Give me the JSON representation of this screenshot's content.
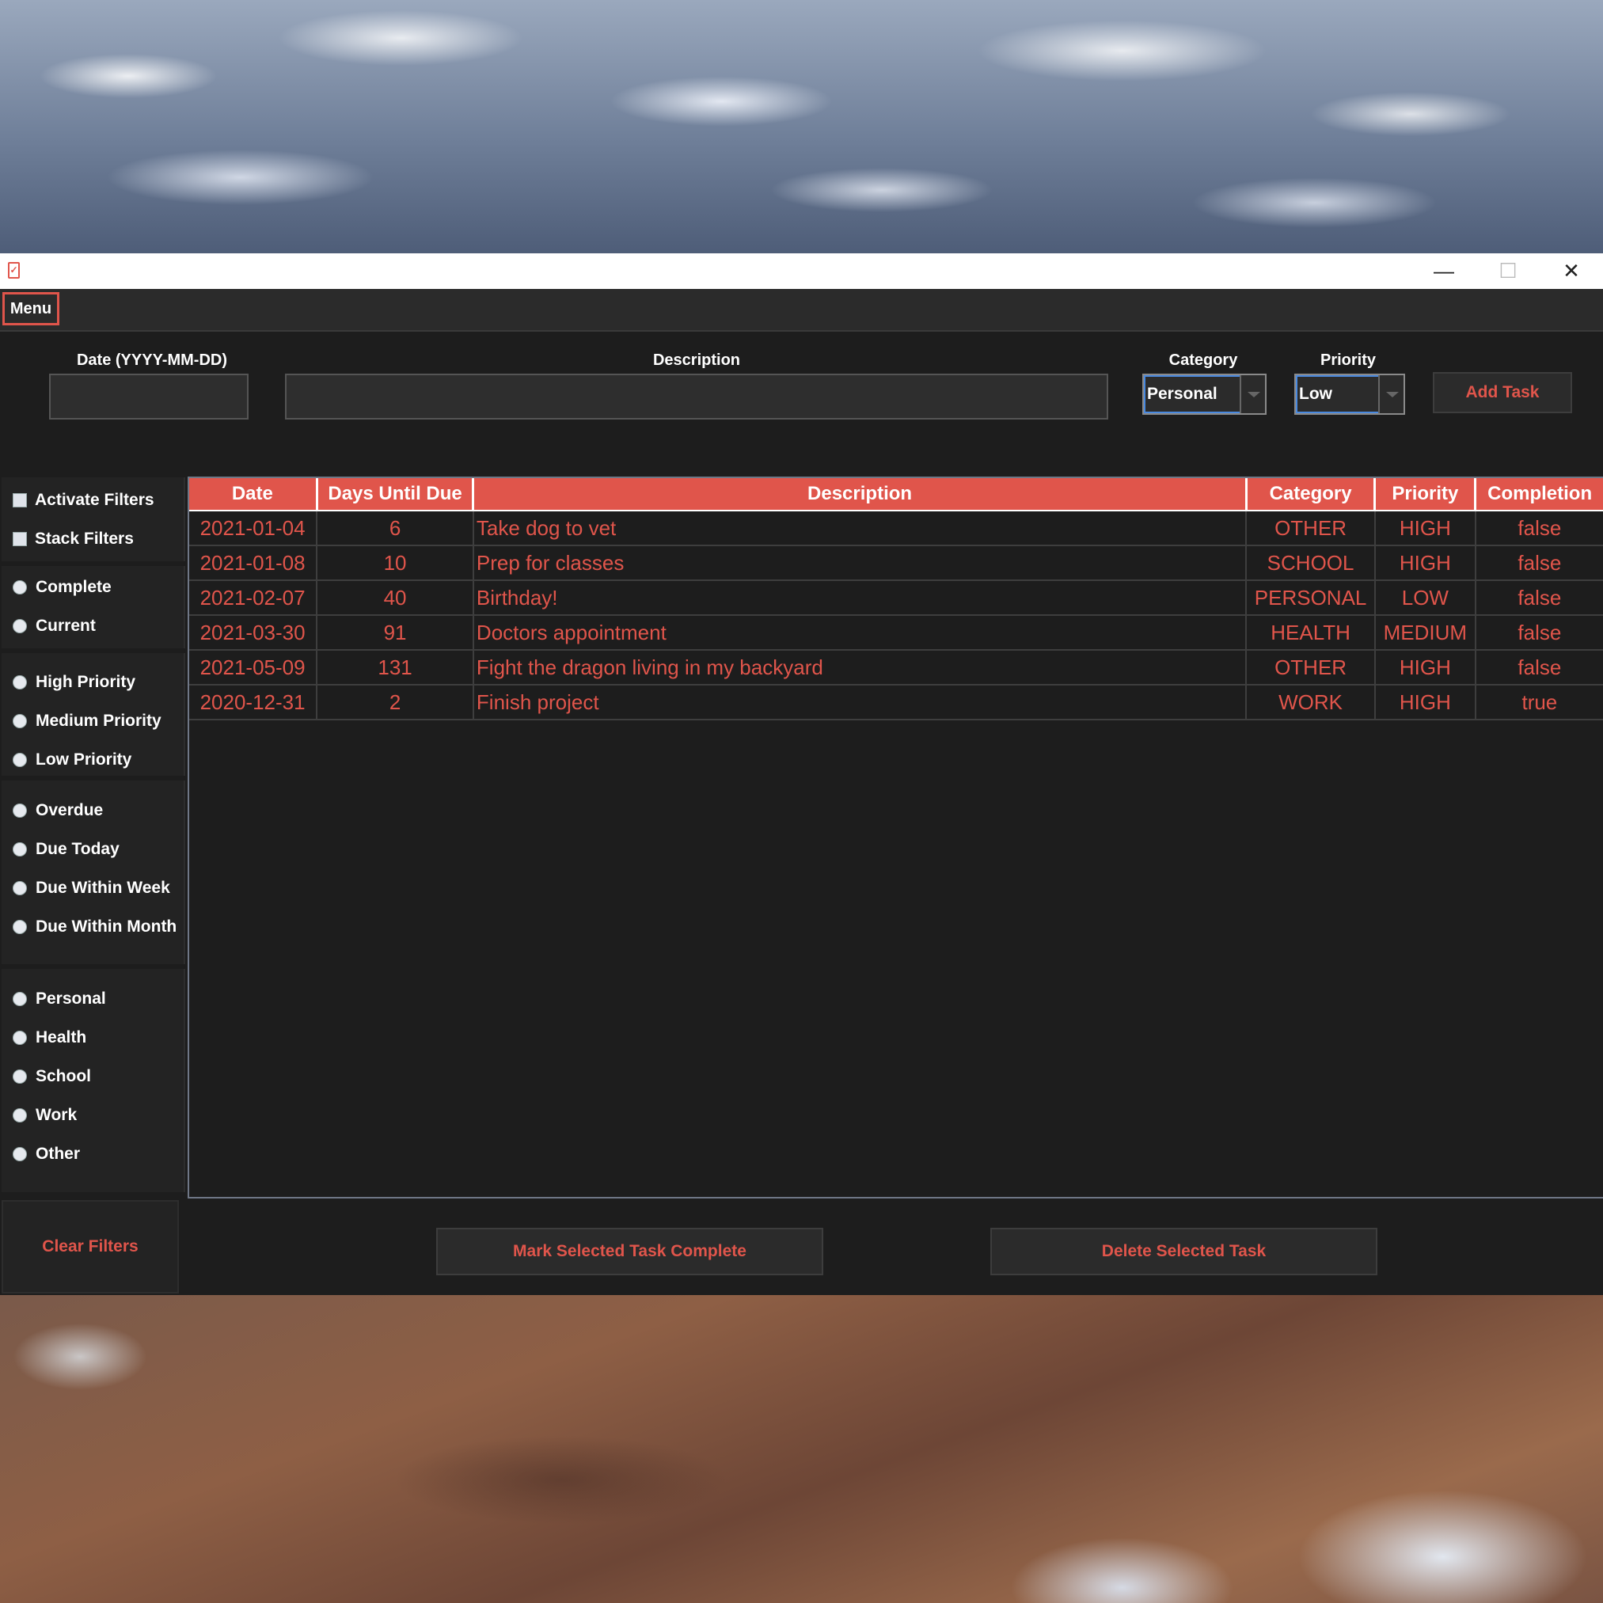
{
  "window": {
    "app_icon": "clipboard-icon",
    "controls": {
      "minimize": "—",
      "maximize": "☐",
      "close": "✕"
    }
  },
  "menu": {
    "label": "Menu"
  },
  "form": {
    "date_label": "Date (YYYY-MM-DD)",
    "date_value": "",
    "description_label": "Description",
    "description_value": "",
    "category_label": "Category",
    "category_value": "Personal",
    "priority_label": "Priority",
    "priority_value": "Low",
    "add_button": "Add Task"
  },
  "filters": {
    "toggles": [
      "Activate Filters",
      "Stack Filters"
    ],
    "status": [
      "Complete",
      "Current"
    ],
    "priority": [
      "High Priority",
      "Medium Priority",
      "Low Priority"
    ],
    "due": [
      "Overdue",
      "Due Today",
      "Due Within Week",
      "Due Within Month"
    ],
    "category": [
      "Personal",
      "Health",
      "School",
      "Work",
      "Other"
    ],
    "clear_button": "Clear Filters"
  },
  "table": {
    "columns": [
      "Date",
      "Days Until Due",
      "Description",
      "Category",
      "Priority",
      "Completion"
    ],
    "rows": [
      [
        "2021-01-04",
        "6",
        "Take dog to vet",
        "OTHER",
        "HIGH",
        "false"
      ],
      [
        "2021-01-08",
        "10",
        "Prep for classes",
        "SCHOOL",
        "HIGH",
        "false"
      ],
      [
        "2021-02-07",
        "40",
        "Birthday!",
        "PERSONAL",
        "LOW",
        "false"
      ],
      [
        "2021-03-30",
        "91",
        "Doctors appointment",
        "HEALTH",
        "MEDIUM",
        "false"
      ],
      [
        "2021-05-09",
        "131",
        "Fight the dragon living in my backyard",
        "OTHER",
        "HIGH",
        "false"
      ],
      [
        "2020-12-31",
        "2",
        "Finish project",
        "WORK",
        "HIGH",
        "true"
      ]
    ]
  },
  "actions": {
    "mark_complete": "Mark Selected Task Complete",
    "delete": "Delete Selected Task"
  },
  "colors": {
    "accent": "#e0554b",
    "background": "#1d1d1d"
  }
}
